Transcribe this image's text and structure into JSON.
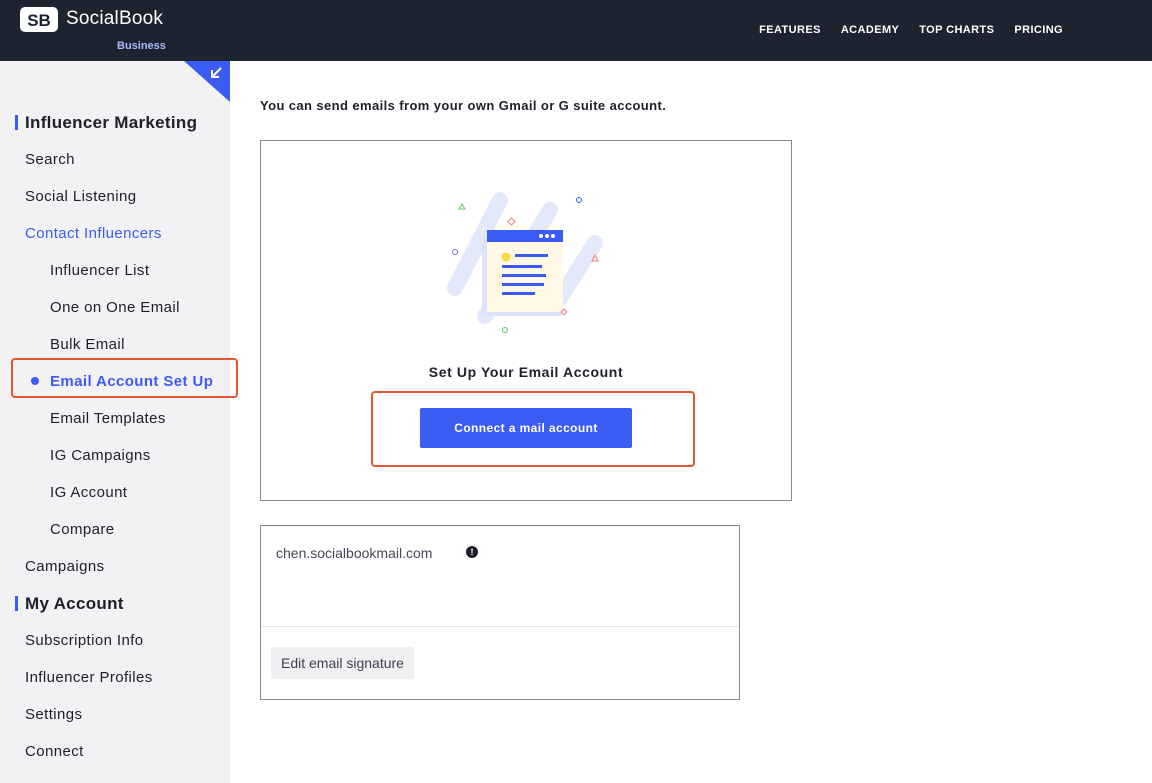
{
  "header": {
    "brand": "SocialBook",
    "brand_sub": "Business",
    "logo_icon": "socialbook-logo-icon",
    "nav": [
      "FEATURES",
      "ACADEMY",
      "TOP CHARTS",
      "PRICING"
    ]
  },
  "sidebar": {
    "collapse_icon": "arrow-down-left-icon",
    "section_influencer": "Influencer Marketing",
    "search": "Search",
    "social_listening": "Social Listening",
    "contact_influencers": "Contact Influencers",
    "influencer_list": "Influencer List",
    "one_on_one_email": "One on One Email",
    "bulk_email": "Bulk Email",
    "email_account_setup": "Email Account Set Up",
    "email_templates": "Email Templates",
    "ig_campaigns": "IG Campaigns",
    "ig_account": "IG Account",
    "compare": "Compare",
    "campaigns": "Campaigns",
    "section_account": "My Account",
    "subscription_info": "Subscription Info",
    "influencer_profiles": "Influencer Profiles",
    "settings": "Settings",
    "connect": "Connect"
  },
  "main": {
    "intro": "You can send emails from your own Gmail or G suite account.",
    "setup_title": "Set Up Your Email Account",
    "connect_button": "Connect a mail account",
    "illustration_icon": "email-setup-illustration-icon",
    "signature_email": "chen.socialbookmail.com",
    "info_icon": "info-icon",
    "edit_signature_button": "Edit email signature"
  },
  "colors": {
    "accent": "#3b5bf5",
    "topbar": "#1e2330",
    "sidebar_bg": "#f2f2f4",
    "highlight": "#e4572e"
  }
}
